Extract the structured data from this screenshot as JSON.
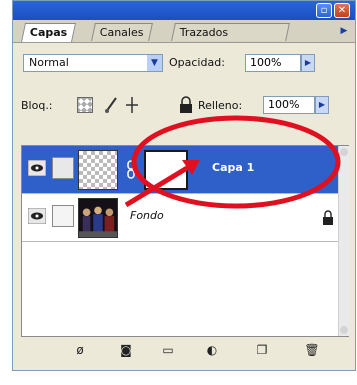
{
  "panel": {
    "tabs": [
      {
        "label": "Capas",
        "active": true
      },
      {
        "label": "Canales",
        "active": false
      },
      {
        "label": "Trazados",
        "active": false
      }
    ]
  },
  "blend_mode": "Normal",
  "opacity": {
    "label": "Opacidad:",
    "value": "100%"
  },
  "lock": {
    "label": "Bloq.:"
  },
  "fill": {
    "label": "Relleno:",
    "value": "100%"
  },
  "layers": [
    {
      "name": "Capa 1",
      "selected": true,
      "thumbnail": "transparent-checker",
      "has_mask": true
    },
    {
      "name": "Fondo",
      "selected": false,
      "thumbnail": "photo",
      "locked": true
    }
  ],
  "colors": {
    "accent": "#2f5fc9",
    "annotation": "#e01020"
  }
}
